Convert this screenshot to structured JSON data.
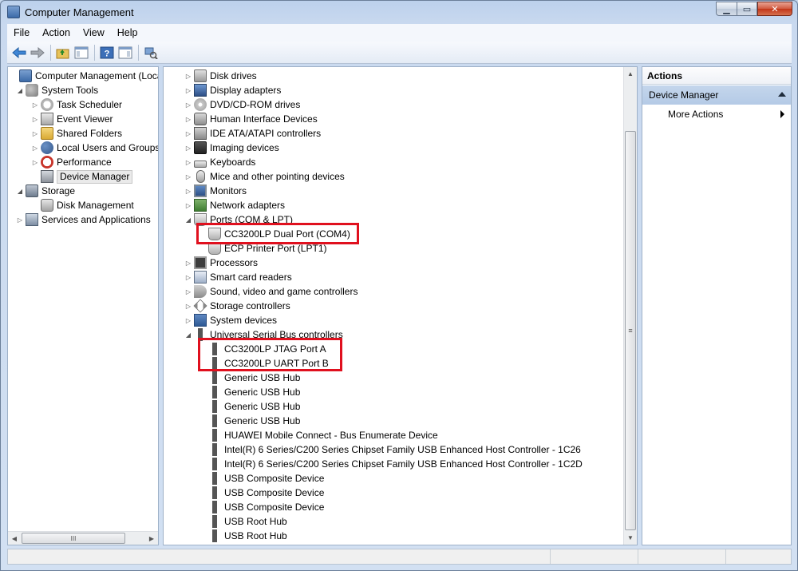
{
  "window": {
    "title": "Computer Management"
  },
  "menu": {
    "file": "File",
    "action": "Action",
    "view": "View",
    "help": "Help"
  },
  "left_tree": [
    {
      "label": "Computer Management (Local",
      "icon": "computer-icon"
    },
    {
      "label": "System Tools",
      "icon": "system-tools-icon"
    },
    {
      "label": "Task Scheduler",
      "icon": "clock-icon"
    },
    {
      "label": "Event Viewer",
      "icon": "event-viewer-icon"
    },
    {
      "label": "Shared Folders",
      "icon": "shared-folders-icon"
    },
    {
      "label": "Local Users and Groups",
      "icon": "users-icon"
    },
    {
      "label": "Performance",
      "icon": "performance-icon"
    },
    {
      "label": "Device Manager",
      "icon": "device-manager-icon"
    },
    {
      "label": "Storage",
      "icon": "storage-icon"
    },
    {
      "label": "Disk Management",
      "icon": "disk-icon"
    },
    {
      "label": "Services and Applications",
      "icon": "services-icon"
    }
  ],
  "left_scroll": {
    "thumb_glyph": "III"
  },
  "devices": [
    {
      "label": "Disk drives"
    },
    {
      "label": "Display adapters"
    },
    {
      "label": "DVD/CD-ROM drives"
    },
    {
      "label": "Human Interface Devices"
    },
    {
      "label": "IDE ATA/ATAPI controllers"
    },
    {
      "label": "Imaging devices"
    },
    {
      "label": "Keyboards"
    },
    {
      "label": "Mice and other pointing devices"
    },
    {
      "label": "Monitors"
    },
    {
      "label": "Network adapters"
    },
    {
      "label": "Ports (COM & LPT)"
    },
    {
      "label": "CC3200LP Dual Port (COM4)"
    },
    {
      "label": "ECP Printer Port (LPT1)"
    },
    {
      "label": "Processors"
    },
    {
      "label": "Smart card readers"
    },
    {
      "label": "Sound, video and game controllers"
    },
    {
      "label": "Storage controllers"
    },
    {
      "label": "System devices"
    },
    {
      "label": "Universal Serial Bus controllers"
    },
    {
      "label": "CC3200LP JTAG Port A"
    },
    {
      "label": "CC3200LP UART Port B"
    },
    {
      "label": "Generic USB Hub"
    },
    {
      "label": "Generic USB Hub"
    },
    {
      "label": "Generic USB Hub"
    },
    {
      "label": "Generic USB Hub"
    },
    {
      "label": "HUAWEI Mobile Connect - Bus Enumerate Device"
    },
    {
      "label": "Intel(R) 6 Series/C200 Series Chipset Family USB Enhanced Host Controller - 1C26"
    },
    {
      "label": "Intel(R) 6 Series/C200 Series Chipset Family USB Enhanced Host Controller - 1C2D"
    },
    {
      "label": "USB Composite Device"
    },
    {
      "label": "USB Composite Device"
    },
    {
      "label": "USB Composite Device"
    },
    {
      "label": "USB Root Hub"
    },
    {
      "label": "USB Root Hub"
    }
  ],
  "actions": {
    "header": "Actions",
    "section": "Device Manager",
    "item": "More Actions"
  },
  "colors": {
    "highlight": "#e0101e",
    "selection": "#eaeaea",
    "actions_section": "#c4d6ec"
  }
}
